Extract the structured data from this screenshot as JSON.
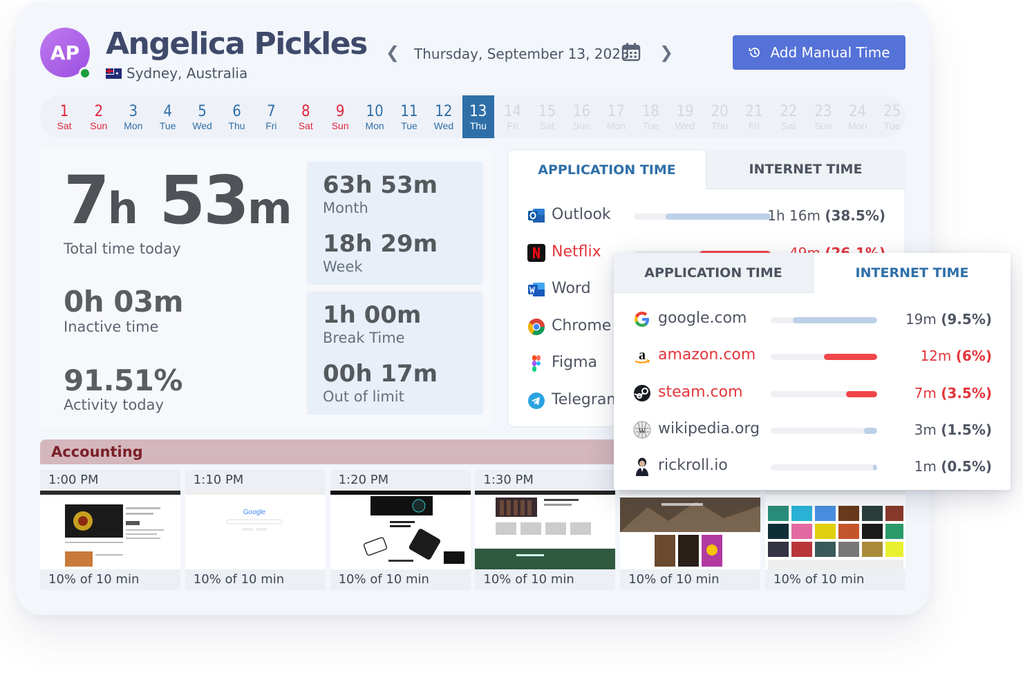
{
  "user": {
    "initials": "AP",
    "name": "Angelica Pickles",
    "location": "Sydney, Australia"
  },
  "date": {
    "label": "Thursday, September 13, 2023"
  },
  "actions": {
    "add_manual_time": "Add Manual Time"
  },
  "days": [
    {
      "num": "1",
      "dow": "Sat",
      "kind": "weekend"
    },
    {
      "num": "2",
      "dow": "Sun",
      "kind": "weekend"
    },
    {
      "num": "3",
      "dow": "Mon",
      "kind": "weekday"
    },
    {
      "num": "4",
      "dow": "Tue",
      "kind": "weekday"
    },
    {
      "num": "5",
      "dow": "Wed",
      "kind": "weekday"
    },
    {
      "num": "6",
      "dow": "Thu",
      "kind": "weekday"
    },
    {
      "num": "7",
      "dow": "Fri",
      "kind": "weekday"
    },
    {
      "num": "8",
      "dow": "Sat",
      "kind": "weekend"
    },
    {
      "num": "9",
      "dow": "Sun",
      "kind": "weekend"
    },
    {
      "num": "10",
      "dow": "Mon",
      "kind": "weekday"
    },
    {
      "num": "11",
      "dow": "Tue",
      "kind": "weekday"
    },
    {
      "num": "12",
      "dow": "Wed",
      "kind": "weekday"
    },
    {
      "num": "13",
      "dow": "Thu",
      "kind": "active"
    },
    {
      "num": "14",
      "dow": "Fri",
      "kind": "future"
    },
    {
      "num": "15",
      "dow": "Sat",
      "kind": "future"
    },
    {
      "num": "16",
      "dow": "Sun",
      "kind": "future"
    },
    {
      "num": "17",
      "dow": "Mon",
      "kind": "future"
    },
    {
      "num": "18",
      "dow": "Tue",
      "kind": "future"
    },
    {
      "num": "19",
      "dow": "Wed",
      "kind": "future"
    },
    {
      "num": "20",
      "dow": "Thu",
      "kind": "future"
    },
    {
      "num": "21",
      "dow": "Fri",
      "kind": "future"
    },
    {
      "num": "22",
      "dow": "Sat",
      "kind": "future"
    },
    {
      "num": "23",
      "dow": "Sun",
      "kind": "future"
    },
    {
      "num": "24",
      "dow": "Mon",
      "kind": "future"
    },
    {
      "num": "25",
      "dow": "Tue",
      "kind": "future"
    }
  ],
  "stats": {
    "total_hours": "7",
    "total_h_unit": "h",
    "total_minutes": "53",
    "total_m_unit": "m",
    "total_label": "Total time today",
    "inactive_value": "0h 03m",
    "inactive_label": "Inactive time",
    "activity_value": "91.51%",
    "activity_label": "Activity today",
    "month_value": "63h 53m",
    "month_label": "Month",
    "week_value": "18h 29m",
    "week_label": "Week",
    "break_value": "1h 00m",
    "break_label": "Break Time",
    "limit_value": "00h 17m",
    "limit_label": "Out of limit"
  },
  "tabs": {
    "application": "APPLICATION TIME",
    "internet": "INTERNET TIME"
  },
  "apps": [
    {
      "name": "Outlook",
      "time": "1h 16m",
      "pct": "(38.5%)",
      "share": 0.385,
      "over": false,
      "icon": "outlook-icon"
    },
    {
      "name": "Netflix",
      "time": "49m",
      "pct": "(26.1%)",
      "share": 0.261,
      "over": true,
      "icon": "netflix-icon"
    },
    {
      "name": "Word",
      "icon": "word-icon"
    },
    {
      "name": "Chrome",
      "icon": "chrome-icon"
    },
    {
      "name": "Figma",
      "icon": "figma-icon"
    },
    {
      "name": "Telegram",
      "icon": "telegram-icon"
    }
  ],
  "sites": [
    {
      "name": "google.com",
      "time": "19m",
      "pct": "(9.5%)",
      "share": 0.095,
      "over": false,
      "icon": "google-icon"
    },
    {
      "name": "amazon.com",
      "time": "12m",
      "pct": "(6%)",
      "share": 0.06,
      "over": true,
      "icon": "amazon-icon"
    },
    {
      "name": "steam.com",
      "time": "7m",
      "pct": "(3.5%)",
      "share": 0.035,
      "over": true,
      "icon": "steam-icon"
    },
    {
      "name": "wikipedia.org",
      "time": "3m",
      "pct": "(1.5%)",
      "share": 0.015,
      "over": false,
      "icon": "wikipedia-icon"
    },
    {
      "name": "rickroll.io",
      "time": "1m",
      "pct": "(0.5%)",
      "share": 0.005,
      "over": false,
      "icon": "rickroll-icon"
    }
  ],
  "project": {
    "name": "Accounting"
  },
  "screenshots": [
    {
      "time": "1:00 PM",
      "caption": "10% of 10 min"
    },
    {
      "time": "1:10 PM",
      "caption": "10% of 10 min"
    },
    {
      "time": "1:20 PM",
      "caption": "10% of 10 min"
    },
    {
      "time": "1:30 PM",
      "caption": "10% of 10 min"
    },
    {
      "time": "",
      "caption": "10% of 10 min"
    },
    {
      "time": "",
      "caption": "10% of 10 min"
    }
  ],
  "colors": {
    "accent": "#2f6fa8",
    "button": "#5572d8",
    "over_limit": "#e4363b",
    "bar_normal": "#bcd0e8",
    "project_bar": "#d4b7bd"
  }
}
